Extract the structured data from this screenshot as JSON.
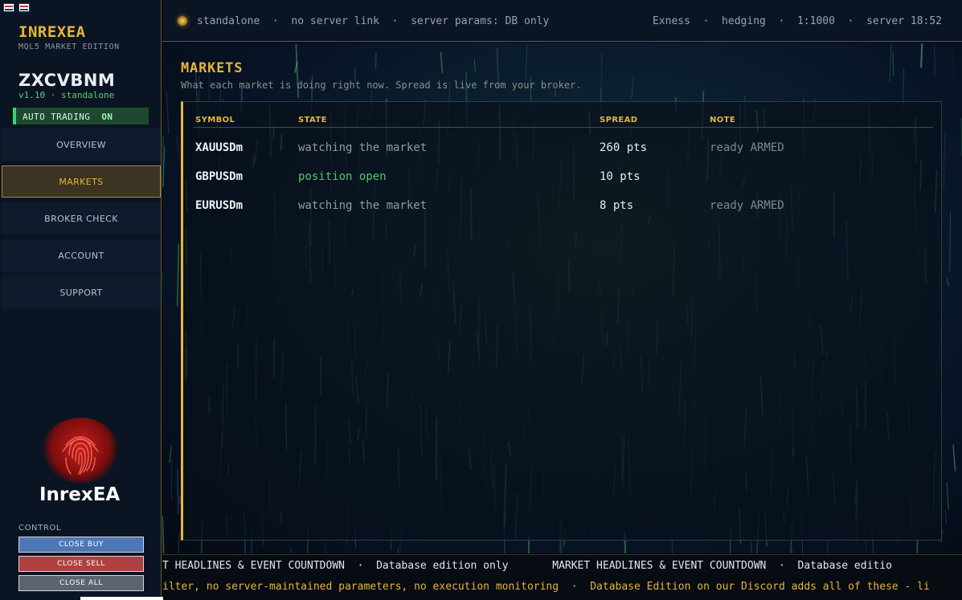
{
  "sidebar": {
    "brand": "INREXEA",
    "brand_sub": "MQL5 MARKET EDITION",
    "account_name": "ZXCVBNM",
    "version_line": "v1.10  ·  standalone",
    "auto_trading_label": "AUTO TRADING",
    "auto_trading_state": "ON",
    "nav": [
      {
        "label": "OVERVIEW",
        "active": false
      },
      {
        "label": "MARKETS",
        "active": true
      },
      {
        "label": "BROKER CHECK",
        "active": false
      },
      {
        "label": "ACCOUNT",
        "active": false
      },
      {
        "label": "SUPPORT",
        "active": false
      }
    ],
    "logo_text": "InrexEA",
    "control_label": "CONTROL",
    "buttons": {
      "close_buy": "CLOSE BUY",
      "close_sell": "CLOSE SELL",
      "close_all": "CLOSE ALL"
    }
  },
  "status_bar": {
    "left": "standalone  ·  no server link  ·  server params: DB only",
    "right": "Exness  ·  hedging  ·  1:1000  ·  server 18:52"
  },
  "main": {
    "title": "MARKETS",
    "subtitle": "What each market is doing right now. Spread is live from your broker.",
    "columns": [
      "SYMBOL",
      "STATE",
      "SPREAD",
      "NOTE"
    ],
    "rows": [
      {
        "symbol": "XAUUSDm",
        "state": "watching the market",
        "spread": "260 pts",
        "note": "ready ARMED"
      },
      {
        "symbol": "GBPUSDm",
        "state": "position open",
        "spread": "10 pts",
        "note": ""
      },
      {
        "symbol": "EURUSDm",
        "state": "watching the market",
        "spread": "8 pts",
        "note": "ready ARMED"
      }
    ]
  },
  "tickers": {
    "line1": "T HEADLINES & EVENT COUNTDOWN  ·  Database edition only       MARKET HEADLINES & EVENT COUNTDOWN  ·  Database editio",
    "line2": "ilter, no server-maintained parameters, no execution monitoring  ·  Database Edition on our Discord adds all of these - li"
  },
  "colors": {
    "accent": "#e6b43c",
    "positive": "#4fc76d",
    "sidebar_bg": "#0b1422",
    "close_buy": "#4d77b6",
    "close_sell": "#b04040"
  }
}
